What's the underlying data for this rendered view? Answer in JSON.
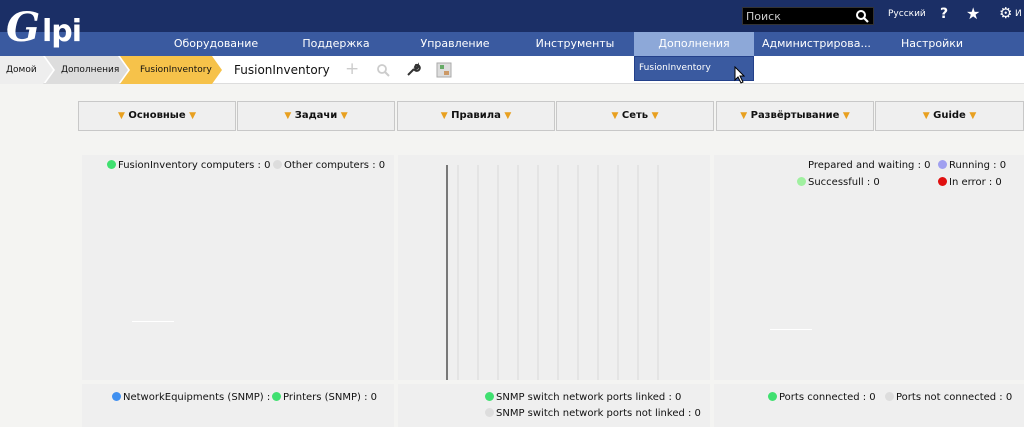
{
  "header": {
    "logo_text": "Glpi",
    "search_placeholder": "Поиск",
    "language": "Русский",
    "user_truncated": "И"
  },
  "menu": {
    "items": [
      {
        "label": "Оборудование"
      },
      {
        "label": "Поддержка"
      },
      {
        "label": "Управление"
      },
      {
        "label": "Инструменты"
      },
      {
        "label": "Дополнения"
      },
      {
        "label": "Администрирова..."
      },
      {
        "label": "Настройки"
      }
    ],
    "dropdown_item": "FusionInventory"
  },
  "breadcrumb": {
    "home": "Домой",
    "plugins": "Дополнения",
    "current": "FusionInventory",
    "title": "FusionInventory"
  },
  "tabs": [
    {
      "label": "Основные"
    },
    {
      "label": "Задачи"
    },
    {
      "label": "Правила"
    },
    {
      "label": "Сеть"
    },
    {
      "label": "Развёртывание"
    },
    {
      "label": "Guide"
    }
  ],
  "panels": {
    "computers": [
      {
        "label": "FusionInventory computers : 0",
        "color": "#40e070"
      },
      {
        "label": "Other computers : 0",
        "color": "#dddddd"
      }
    ],
    "tasks": [
      {
        "label": "Prepared and waiting : 0",
        "color": "#efefef"
      },
      {
        "label": "Running : 0",
        "color": "#a0a0f0"
      },
      {
        "label": "Successfull : 0",
        "color": "#a0f0a0"
      },
      {
        "label": "In error : 0",
        "color": "#e01010"
      }
    ],
    "snmp_devices": [
      {
        "label": "NetworkEquipments (SNMP) : 0",
        "color": "#4090f0"
      },
      {
        "label": "Printers (SNMP) : 0",
        "color": "#40e070"
      }
    ],
    "switch_ports": [
      {
        "label": "SNMP switch network ports linked : 0",
        "color": "#40e070"
      },
      {
        "label": "SNMP switch network ports not linked : 0",
        "color": "#dddddd"
      }
    ],
    "ports": [
      {
        "label": "Ports connected : 0",
        "color": "#40e070"
      },
      {
        "label": "Ports not connected : 0",
        "color": "#dddddd"
      }
    ]
  }
}
